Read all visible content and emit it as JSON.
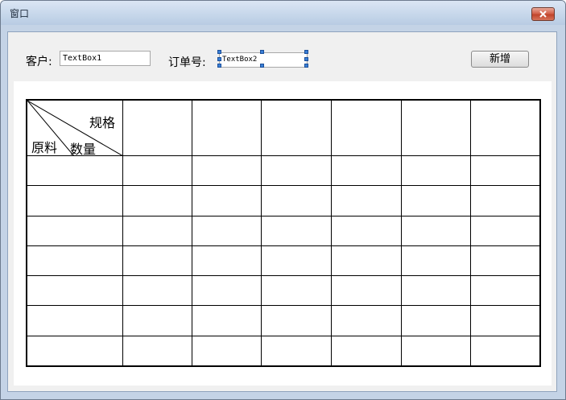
{
  "window": {
    "title": "窗口"
  },
  "form": {
    "customer_label": "客户:",
    "customer_value": "TextBox1",
    "order_label": "订单号:",
    "order_value": "TextBox2",
    "new_button": "新增"
  },
  "table": {
    "header": {
      "top_right": "规格",
      "bottom_left": "原料",
      "bottom_middle": "数量"
    },
    "spec_columns": 6,
    "data_rows": 7
  }
}
